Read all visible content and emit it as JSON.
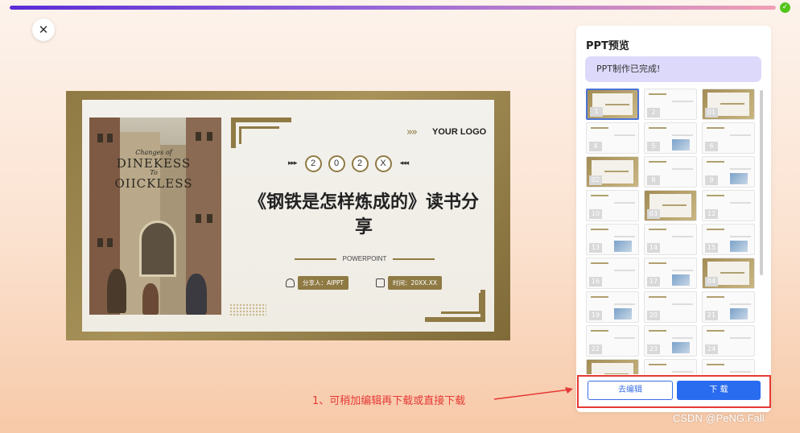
{
  "progress": {
    "percent": 100,
    "check_icon": "check-circle-icon"
  },
  "close_button": {
    "icon": "close-icon",
    "glyph": "✕"
  },
  "slide": {
    "logo_text": "YOUR LOGO",
    "chevrons": "»»",
    "year_left_arrows": "▸▸▸",
    "year_right_arrows": "◂◂◂",
    "year_digits": [
      "2",
      "0",
      "2",
      "X"
    ],
    "title": "《钢铁是怎样炼成的》读书分享",
    "subtitle": "POWERPOINT",
    "presenter": "分享人：AIPPT",
    "time": "时间：20XX.XX",
    "photo_text_small": "Changes of",
    "photo_text_line1": "DINEKESS",
    "photo_text_mid": "To",
    "photo_text_line2": "OIICKLESS",
    "accent_color": "#8f7a44"
  },
  "panel": {
    "title": "PPT预览",
    "status": "PPT制作已完成!",
    "thumbnails": [
      {
        "num": "1",
        "style": "gold",
        "selected": true
      },
      {
        "num": "2",
        "style": "plain"
      },
      {
        "num": "01",
        "style": "gold"
      },
      {
        "num": "4",
        "style": "plain"
      },
      {
        "num": "5",
        "style": "plain"
      },
      {
        "num": "6",
        "style": "plain"
      },
      {
        "num": "02",
        "style": "gold"
      },
      {
        "num": "8",
        "style": "plain"
      },
      {
        "num": "9",
        "style": "plain"
      },
      {
        "num": "10",
        "style": "plain"
      },
      {
        "num": "03",
        "style": "gold"
      },
      {
        "num": "12",
        "style": "plain"
      },
      {
        "num": "13",
        "style": "plain"
      },
      {
        "num": "14",
        "style": "plain"
      },
      {
        "num": "15",
        "style": "plain"
      },
      {
        "num": "16",
        "style": "plain"
      },
      {
        "num": "17",
        "style": "plain"
      },
      {
        "num": "04",
        "style": "gold"
      },
      {
        "num": "19",
        "style": "plain"
      },
      {
        "num": "20",
        "style": "plain"
      },
      {
        "num": "21",
        "style": "plain"
      },
      {
        "num": "22",
        "style": "plain"
      },
      {
        "num": "23",
        "style": "plain"
      },
      {
        "num": "24",
        "style": "plain"
      },
      {
        "num": "",
        "style": "gold"
      },
      {
        "num": "",
        "style": "plain"
      },
      {
        "num": "",
        "style": "plain"
      }
    ]
  },
  "buttons": {
    "edit": "去编辑",
    "download": "下 载"
  },
  "annotation": "1、可稍加编辑再下载或直接下载",
  "watermark": "CSDN @PeNG.Fall"
}
